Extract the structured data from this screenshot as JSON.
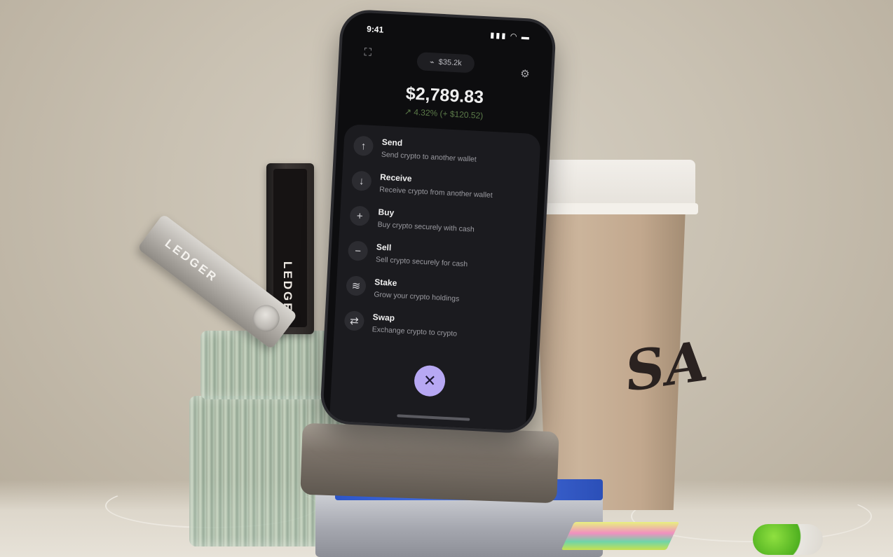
{
  "phone": {
    "status": {
      "time": "9:41",
      "icons": "▮▮▮ ◠ ▬"
    },
    "pill": {
      "icon": "trend-icon",
      "value": "$35.2k"
    },
    "balance": "$2,789.83",
    "change": "↗ 4.32% (+ $120.52)",
    "actions": [
      {
        "title": "Send",
        "subtitle": "Send crypto to another wallet",
        "icon": "arrow-up-icon",
        "glyph": "↑"
      },
      {
        "title": "Receive",
        "subtitle": "Receive crypto from another wallet",
        "icon": "arrow-down-icon",
        "glyph": "↓"
      },
      {
        "title": "Buy",
        "subtitle": "Buy crypto securely with cash",
        "icon": "plus-icon",
        "glyph": "+"
      },
      {
        "title": "Sell",
        "subtitle": "Sell crypto securely for cash",
        "icon": "minus-icon",
        "glyph": "−"
      },
      {
        "title": "Stake",
        "subtitle": "Grow your crypto holdings",
        "icon": "coins-icon",
        "glyph": "≋"
      },
      {
        "title": "Swap",
        "subtitle": "Exchange crypto to crypto",
        "icon": "swap-icon",
        "glyph": "⇄"
      }
    ],
    "close_glyph": "✕",
    "accent": "#b7a8f3"
  },
  "scene": {
    "ledger_silver_label": "LEDGER",
    "ledger_dark_label": "LEDGER",
    "cup_logo": "SA"
  }
}
